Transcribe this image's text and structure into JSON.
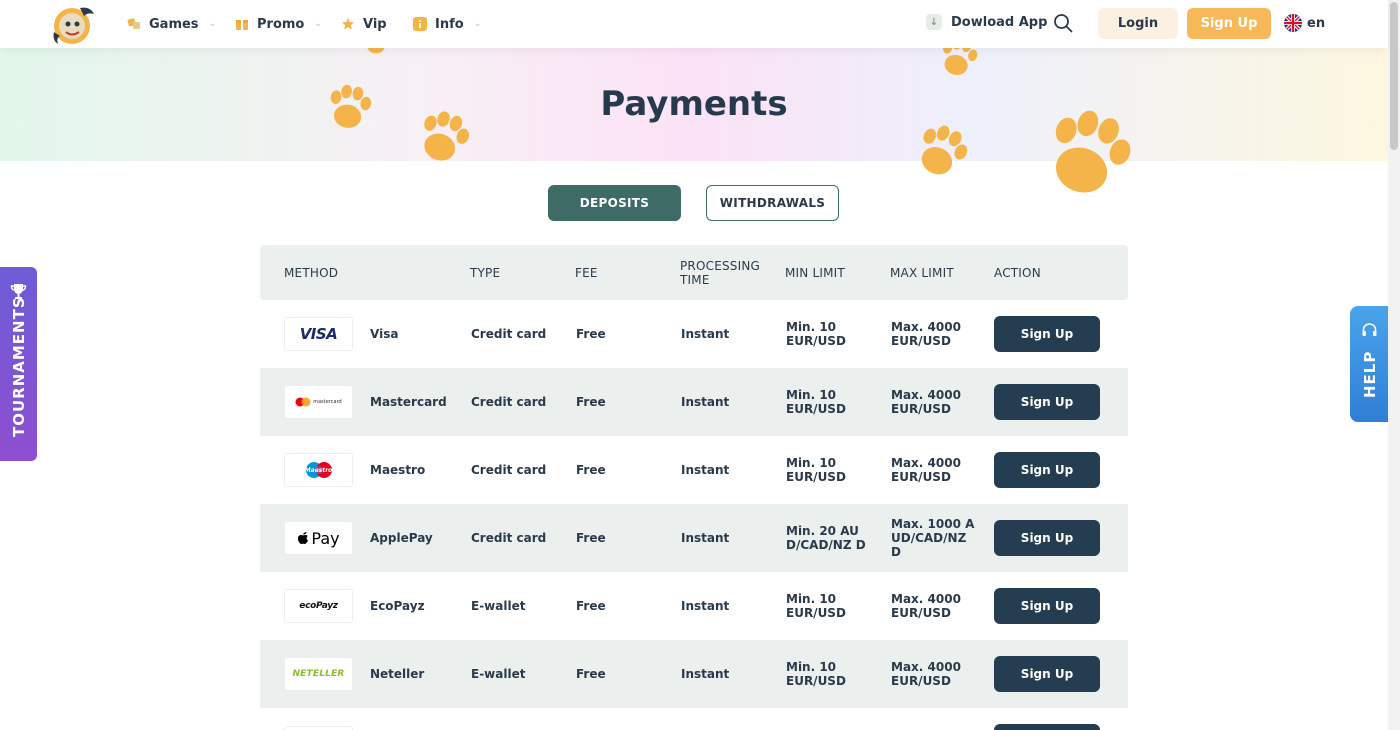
{
  "colors": {
    "accent_orange": "#f7b85a",
    "tab_active": "#3e6b66",
    "row_button": "#243d50",
    "tournaments_purple": "#7a56d3",
    "help_blue": "#3a8fe0",
    "paw": "#f5b449"
  },
  "header": {
    "logo_icon": "cobra-casino-logo",
    "nav": [
      {
        "label": "Games",
        "icon": "games-icon",
        "has_dropdown": true
      },
      {
        "label": "Promo",
        "icon": "gift-icon",
        "has_dropdown": true
      },
      {
        "label": "Vip",
        "icon": "star-icon",
        "has_dropdown": false
      },
      {
        "label": "Info",
        "icon": "info-icon",
        "has_dropdown": true
      }
    ],
    "download_label": "Dowload App",
    "login_label": "Login",
    "signup_label": "Sign Up",
    "language": "en"
  },
  "hero": {
    "title": "Payments"
  },
  "tabs": {
    "deposits": "DEPOSITS",
    "withdrawals": "WITHDRAWALS"
  },
  "table": {
    "headers": {
      "method": "METHOD",
      "type": "TYPE",
      "fee": "FEE",
      "processing_time": "PROCESSING TIME",
      "min_limit": "MIN LIMIT",
      "max_limit": "MAX LIMIT",
      "action": "ACTION"
    },
    "rows": [
      {
        "logo": "VISA",
        "name": "Visa",
        "type": "Credit card",
        "fee": "Free",
        "time": "Instant",
        "min": "Min. 10 EUR/USD",
        "max": "Max. 4000 EUR/USD",
        "action": "Sign Up"
      },
      {
        "logo": "mastercard",
        "name": "Mastercard",
        "type": "Credit card",
        "fee": "Free",
        "time": "Instant",
        "min": "Min. 10 EUR/USD",
        "max": "Max. 4000 EUR/USD",
        "action": "Sign Up"
      },
      {
        "logo": "Maestro",
        "name": "Maestro",
        "type": "Credit card",
        "fee": "Free",
        "time": "Instant",
        "min": "Min. 10 EUR/USD",
        "max": "Max. 4000 EUR/USD",
        "action": "Sign Up"
      },
      {
        "logo": "Pay",
        "name": "ApplePay",
        "type": "Credit card",
        "fee": "Free",
        "time": "Instant",
        "min": "Min. 20 AUD/CAD/NZ D",
        "max": "Max. 1000 AUD/CAD/NZ D",
        "action": "Sign Up"
      },
      {
        "logo": "ecoPayz",
        "name": "EcoPayz",
        "type": "E-wallet",
        "fee": "Free",
        "time": "Instant",
        "min": "Min. 10 EUR/USD",
        "max": "Max. 4000 EUR/USD",
        "action": "Sign Up"
      },
      {
        "logo": "NETELLER",
        "name": "Neteller",
        "type": "E-wallet",
        "fee": "Free",
        "time": "Instant",
        "min": "Min. 10 EUR/USD",
        "max": "Max. 4000 EUR/USD",
        "action": "Sign Up"
      }
    ]
  },
  "side": {
    "tournaments_label": "TOURNAMENTS",
    "help_label": "HELP"
  }
}
